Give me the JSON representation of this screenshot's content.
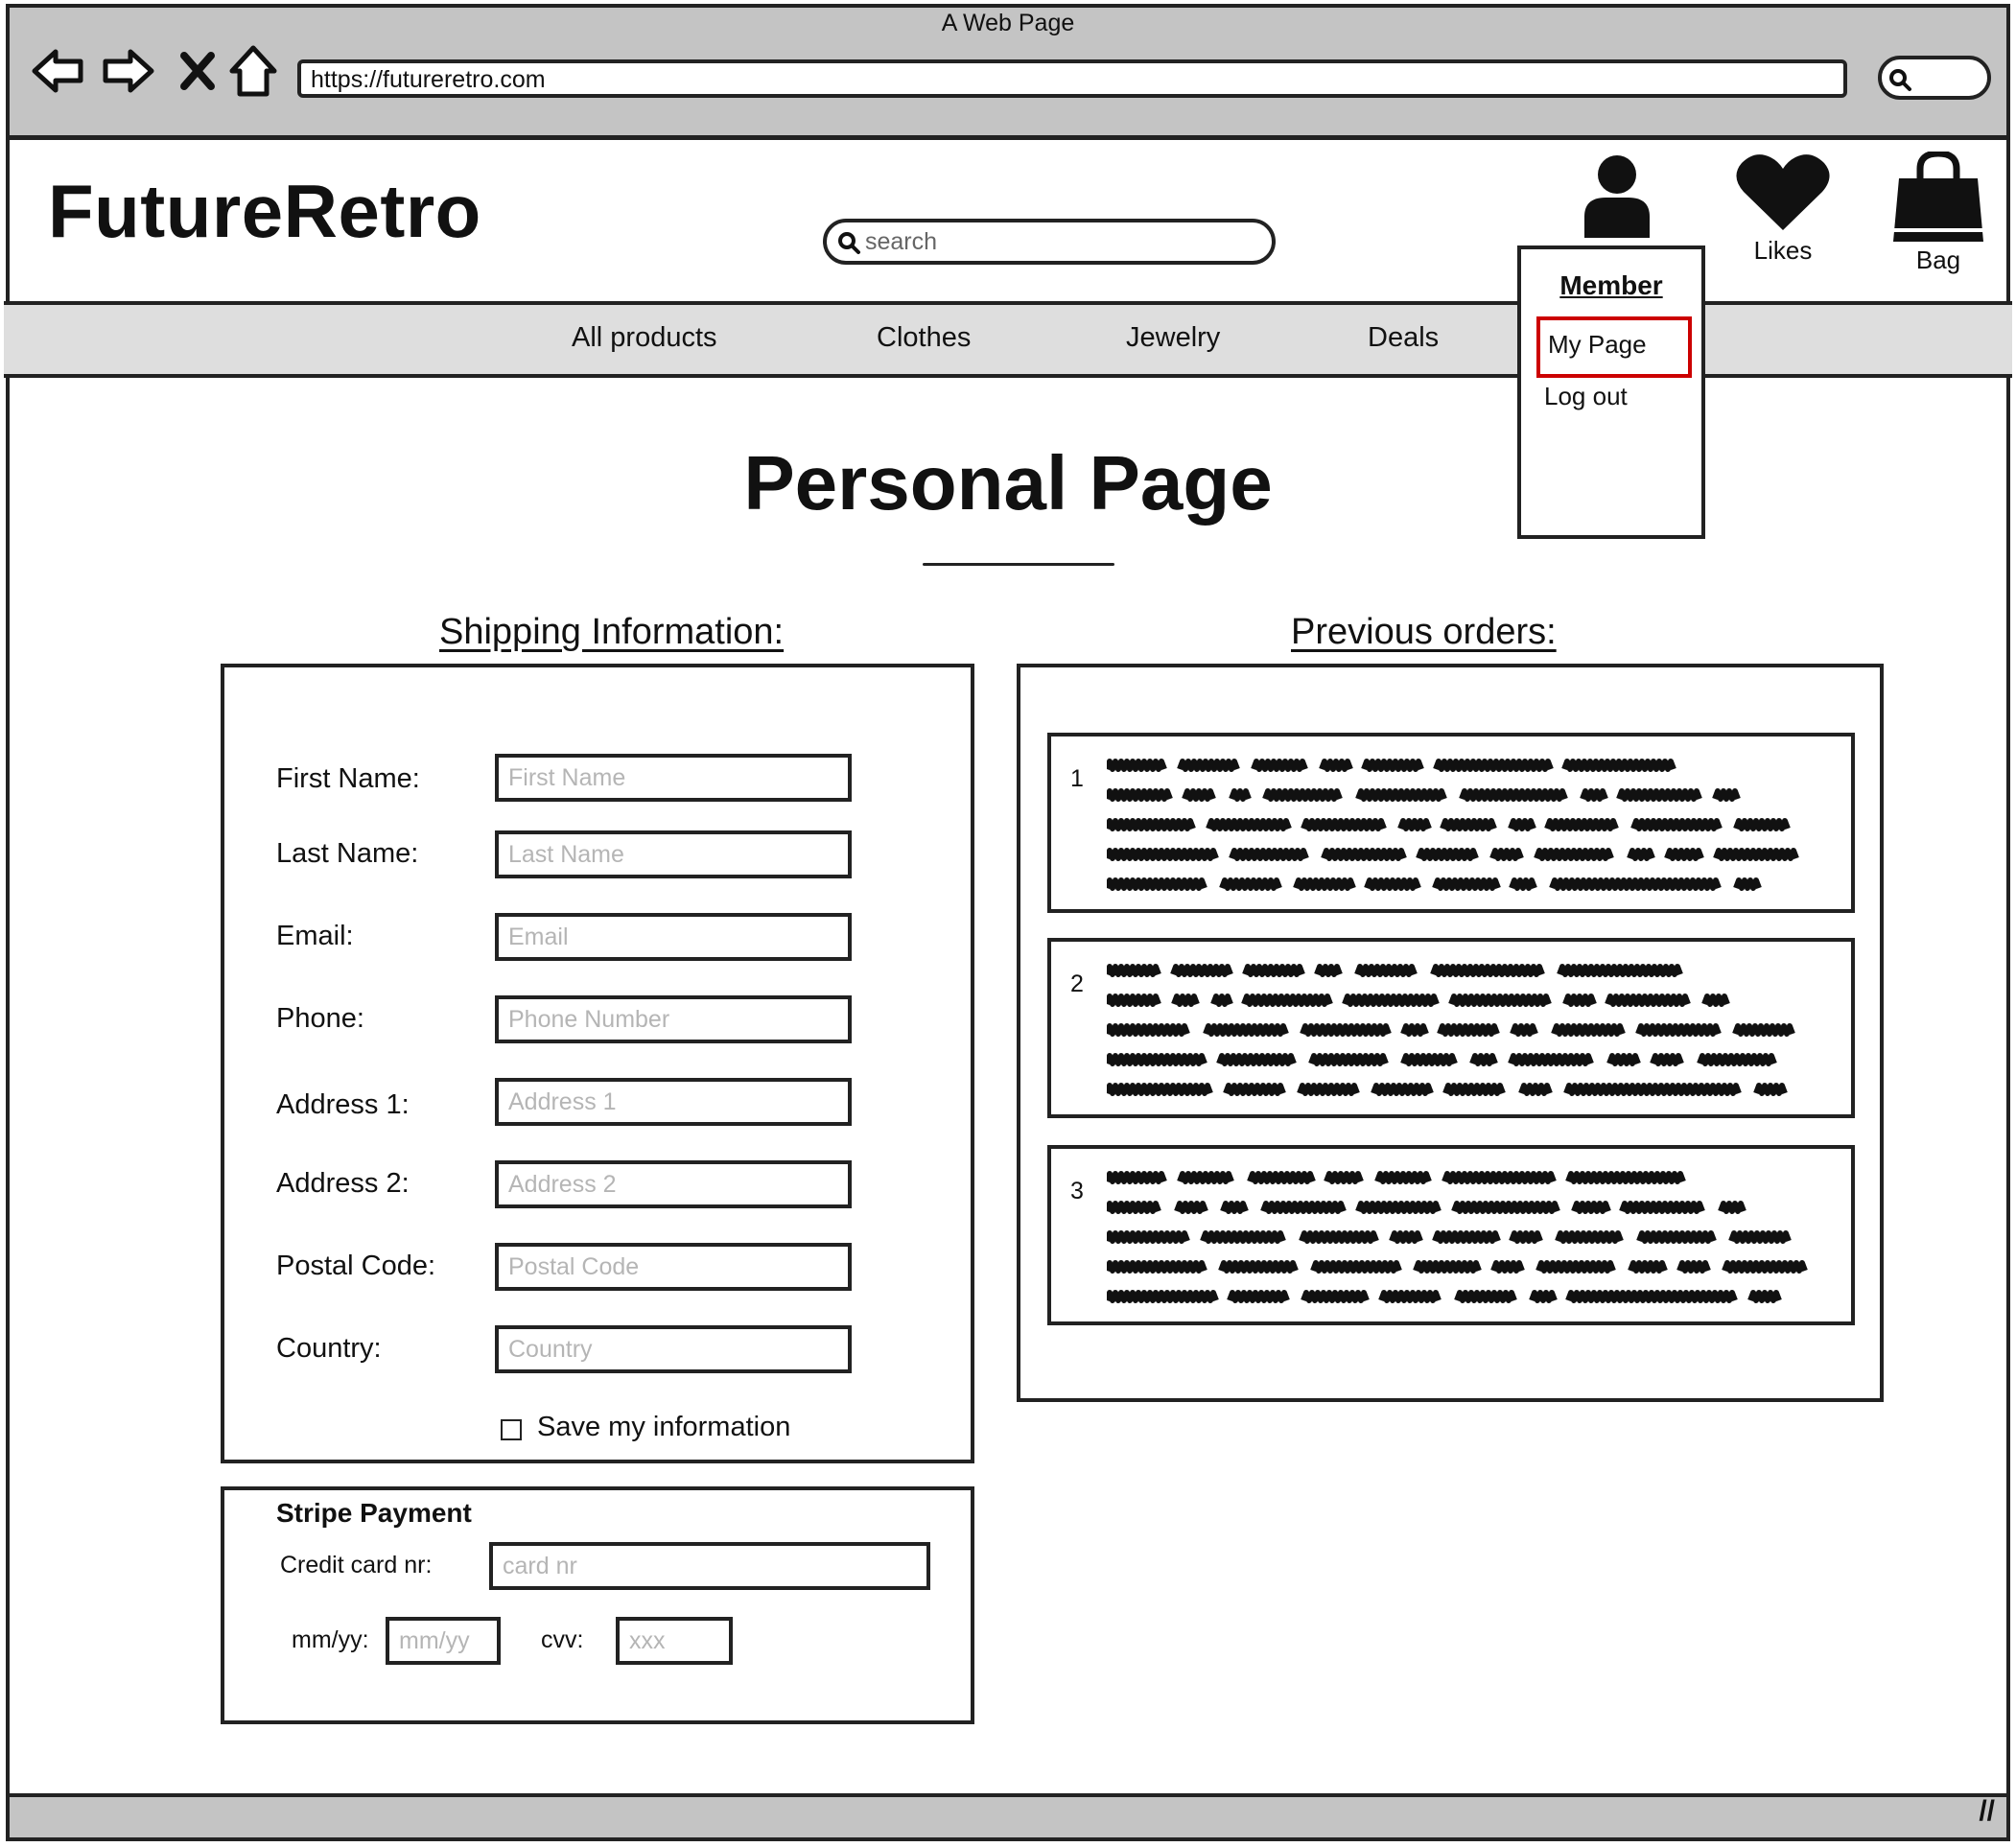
{
  "browser": {
    "window_title": "A Web Page",
    "url": "https://futureretro.com"
  },
  "header": {
    "logo": "FutureRetro",
    "search_placeholder": "search",
    "likes_label": "Likes",
    "bag_label": "Bag"
  },
  "nav": {
    "items": [
      "All products",
      "Clothes",
      "Jewelry",
      "Deals"
    ]
  },
  "member_menu": {
    "title": "Member",
    "items": [
      "My Page",
      "Log out"
    ]
  },
  "page": {
    "title": "Personal Page"
  },
  "shipping": {
    "title": "Shipping Information:",
    "fields": [
      {
        "label": "First Name:",
        "placeholder": "First Name"
      },
      {
        "label": "Last Name:",
        "placeholder": "Last Name"
      },
      {
        "label": "Email:",
        "placeholder": "Email"
      },
      {
        "label": "Phone:",
        "placeholder": "Phone Number"
      },
      {
        "label": "Address 1:",
        "placeholder": "Address 1"
      },
      {
        "label": "Address 2:",
        "placeholder": "Address 2"
      },
      {
        "label": "Postal Code:",
        "placeholder": "Postal Code"
      },
      {
        "label": "Country:",
        "placeholder": "Country"
      }
    ],
    "save_label": "Save my information"
  },
  "payment": {
    "title": "Stripe Payment",
    "card_label": "Credit card nr:",
    "card_placeholder": "card nr",
    "expiry_label": "mm/yy:",
    "expiry_placeholder": "mm/yy",
    "cvv_label": "cvv:",
    "cvv_placeholder": "xxx"
  },
  "orders": {
    "title": "Previous orders:",
    "items": [
      {
        "number": "1"
      },
      {
        "number": "2"
      },
      {
        "number": "3"
      }
    ]
  }
}
